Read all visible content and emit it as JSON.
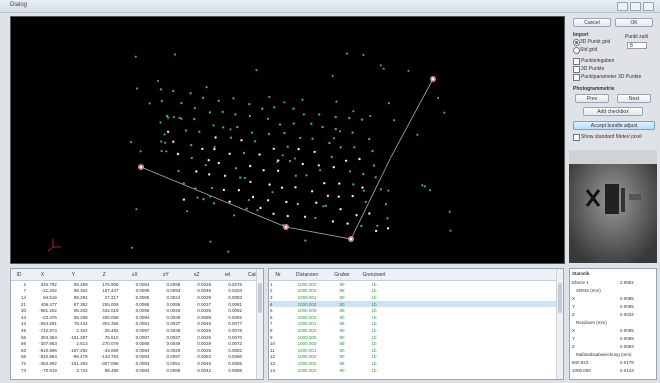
{
  "window": {
    "title": "Dialog"
  },
  "buttons": {
    "cancel": "Cancel",
    "ok": "OK"
  },
  "panel": {
    "input_group": "Import",
    "radio_points": "3D Punkt grid",
    "radio_target": "Std grid",
    "points_label": "Punkt zahl",
    "points_value": "8",
    "checkboxes": [
      "Punkteingaben",
      "3D Punkte",
      "Punktparameter 3D Punkte"
    ],
    "photo_group": "Photogrammetrie",
    "prev_label": "Prev",
    "next_label": "Next",
    "add_label": "Add checkbox",
    "accept_label": "Accept bundle adjust",
    "show_label": "Show standard Meter/ pixel"
  },
  "main_table": {
    "headers": [
      "ID",
      "X",
      "Y",
      "Z",
      "sX",
      "sY",
      "sZ",
      "rel",
      "Calc"
    ],
    "rows": [
      [
        "2",
        "320.792",
        "95.259",
        "176.906",
        "0.0084",
        "0.0095",
        "0.0028",
        "0.0276",
        "9"
      ],
      [
        "7",
        "-21.202",
        "98.304",
        "107.447",
        "0.0095",
        "0.0093",
        "0.0048",
        "0.0203",
        "11"
      ],
      [
        "14",
        "94.516",
        "85.294",
        "27.317",
        "0.0096",
        "0.0024",
        "0.0029",
        "0.0083",
        "12"
      ],
      [
        "21",
        "406.477",
        "87.352",
        "255.008",
        "0.0095",
        "0.0095",
        "0.0037",
        "0.0081",
        "10"
      ],
      [
        "30",
        "-581.202",
        "98.202",
        "432.019",
        "0.0096",
        "0.0029",
        "0.0026",
        "0.0092",
        "12"
      ],
      [
        "44",
        "-23.376",
        "98.288",
        "400.059",
        "0.0094",
        "0.0039",
        "0.0098",
        "0.0092",
        "11"
      ],
      [
        "43",
        "-594.691",
        "78.444",
        "304.356",
        "0.0081",
        "0.0037",
        "0.0049",
        "0.0077",
        "12"
      ],
      [
        "45",
        "-742.974",
        "2.324",
        "-25.482",
        "0.0097",
        "0.0038",
        "0.0026",
        "0.0076",
        "12"
      ],
      [
        "56",
        "353.363",
        "-181.287",
        "75.510",
        "0.0087",
        "0.0037",
        "0.0026",
        "0.0070",
        "12"
      ],
      [
        "56",
        "-307.963",
        "2.613",
        "270.078",
        "0.0085",
        "0.0049",
        "0.0029",
        "0.0072",
        "12"
      ],
      [
        "63",
        "-810.996",
        "-187.292",
        "-43.069",
        "0.0094",
        "0.0029",
        "0.0025",
        "0.0082",
        "11"
      ],
      [
        "68",
        "-810.984",
        "-96.479",
        "-143.763",
        "0.0083",
        "0.0097",
        "0.0053",
        "0.0080",
        "9"
      ],
      [
        "72",
        "-363.982",
        "-181.283",
        "-307.096",
        "0.0093",
        "0.0051",
        "0.0049",
        "0.0085",
        "12"
      ],
      [
        "73",
        "-70.819",
        "3.722",
        "98.490",
        "0.0084",
        "0.0089",
        "0.0042",
        "0.0086",
        "11"
      ]
    ]
  },
  "dist_table": {
    "headers": [
      "Nr",
      "Distanzen",
      "Gruber",
      "Grenzwert"
    ],
    "rows": [
      [
        "1",
        "1000.002",
        "90",
        "1b"
      ],
      [
        "2",
        "1000.003",
        "88",
        "1b"
      ],
      [
        "3",
        "1000.001",
        "90",
        "1b"
      ],
      [
        "4",
        "1000.002",
        "90",
        "1b"
      ],
      [
        "5",
        "1000.000",
        "88",
        "1b"
      ],
      [
        "6",
        "1000.003",
        "90",
        "1b"
      ],
      [
        "7",
        "1000.001",
        "88",
        "1b"
      ],
      [
        "8",
        "1000.002",
        "90",
        "1b"
      ],
      [
        "9",
        "1000.000",
        "90",
        "1b"
      ],
      [
        "10",
        "1000.003",
        "88",
        "1b"
      ],
      [
        "11",
        "1000.001",
        "90",
        "1b"
      ],
      [
        "12",
        "1000.002",
        "90",
        "1b"
      ],
      [
        "13",
        "1000.000",
        "88",
        "1b"
      ],
      [
        "14",
        "1000.002",
        "90",
        "1b"
      ]
    ],
    "selected_row": 3
  },
  "props": {
    "header": "Statistik",
    "rows": [
      [
        "Ebene 1",
        "2.9962"
      ],
      [
        "SRMS (mm)",
        ""
      ],
      [
        "X",
        "0.0085"
      ],
      [
        "Y",
        "0.0095"
      ],
      [
        "Z",
        "0.0034"
      ],
      [
        "Residuen (mm)",
        ""
      ],
      [
        "X",
        "0.0095"
      ],
      [
        "Y",
        "0.0089"
      ],
      [
        "Z",
        "0.0083"
      ],
      [
        "Maßstabsabweichung (mm)",
        ""
      ],
      [
        "600.923",
        "0.0178"
      ],
      [
        "1000.000",
        "0.0143"
      ]
    ]
  },
  "colors": {
    "green_points": "#2fb55a",
    "white_points": "#e6e6e6",
    "viewport_bg": "#000000"
  }
}
